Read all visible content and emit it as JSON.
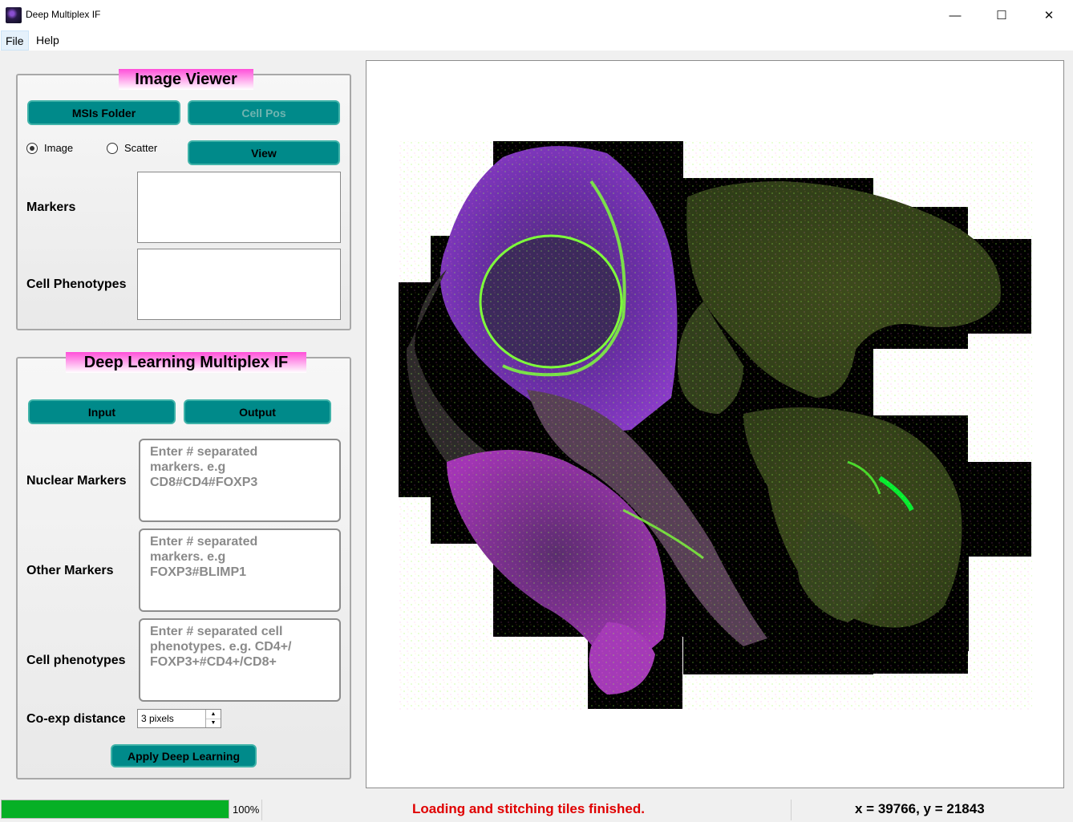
{
  "window": {
    "title": "Deep Multiplex IF",
    "minimize_glyph": "—",
    "maximize_glyph": "☐",
    "close_glyph": "✕"
  },
  "menu": {
    "items": [
      "File",
      "Help"
    ]
  },
  "image_viewer": {
    "title": "Image Viewer",
    "msis_folder_label": "MSIs Folder",
    "cell_pos_label": "Cell Pos",
    "radio_image_label": "Image",
    "radio_scatter_label": "Scatter",
    "selected_mode": "Image",
    "view_label": "View",
    "markers_label": "Markers",
    "cell_phenotypes_label": "Cell Phenotypes"
  },
  "deep_learning": {
    "title": "Deep Learning Multiplex IF",
    "input_label": "Input",
    "output_label": "Output",
    "nuclear_markers_label": "Nuclear Markers",
    "nuclear_markers_placeholder": "Enter # separated\nmarkers. e.g\nCD8#CD4#FOXP3",
    "other_markers_label": "Other Markers",
    "other_markers_placeholder": "Enter # separated\nmarkers. e.g\nFOXP3#BLIMP1",
    "cell_phenotypes_label": "Cell phenotypes",
    "cell_phenotypes_placeholder": "Enter # separated cell\nphenotypes. e.g. CD4+/\nFOXP3+#CD4+/CD8+",
    "coexp_label": "Co-exp distance",
    "coexp_value": "3 pixels",
    "apply_label": "Apply Deep Learning"
  },
  "status": {
    "progress_percent": 100,
    "progress_text": "100%",
    "message": "Loading and stitching tiles finished.",
    "coords": "x = 39766, y = 21843"
  },
  "colors": {
    "button_teal": "#008a8a",
    "group_title_magenta": "#ff4fd9",
    "status_red": "#e00000",
    "progress_green": "#06b025"
  }
}
